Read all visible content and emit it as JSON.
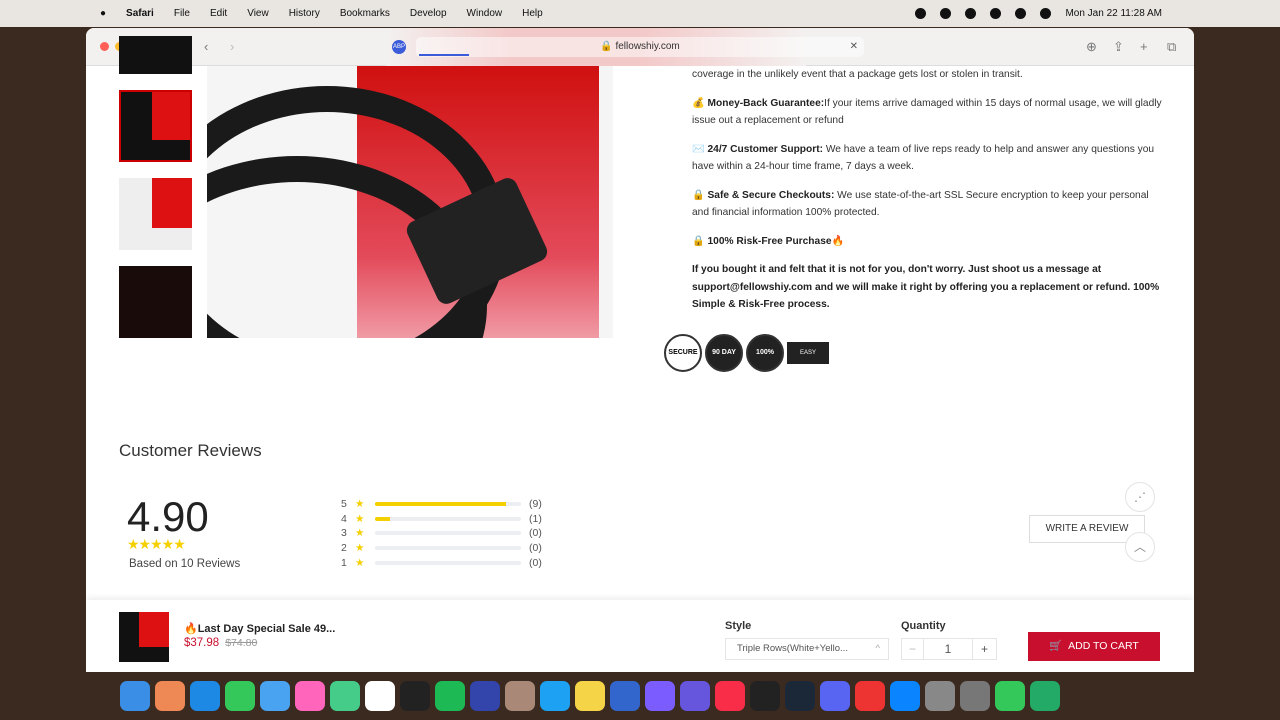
{
  "menubar": {
    "app": "Safari",
    "items": [
      "File",
      "Edit",
      "View",
      "History",
      "Bookmarks",
      "Develop",
      "Window",
      "Help"
    ],
    "clock": "Mon Jan 22  11:28 AM"
  },
  "browser": {
    "url": "fellowshiy.com",
    "abp": "ABP"
  },
  "info": {
    "p0": "coverage in the unlikely event that a package gets lost or stolen in transit.",
    "p1_title": "Money-Back Guarantee:",
    "p1_text": "If your items arrive damaged within 15 days of normal usage, we will gladly issue out a replacement or refund",
    "p2_title": "24/7 Customer Support:",
    "p2_text": " We have a team of live reps ready to help and answer any questions you have within a 24-hour time frame, 7 days a week.",
    "p3_title": "Safe & Secure Checkouts:",
    "p3_text": " We use state-of-the-art SSL Secure encryption to keep your personal and financial information 100% protected.",
    "p4_title": "100% Risk-Free Purchase🔥",
    "p5": "If you bought it and felt that it is not for you, don't worry. Just shoot us a message at support@fellowshiy.com and we will make it right by offering you a replacement or refund. 100% Simple & Risk-Free process."
  },
  "badges": [
    "SECURE",
    "90 DAY",
    "100%",
    "EASY RETURN"
  ],
  "reviews": {
    "title": "Customer Reviews",
    "score": "4.90",
    "stars": "★★★★★",
    "based": "Based on 10 Reviews",
    "write": "WRITE A REVIEW",
    "rows": [
      {
        "star": "5",
        "count": "(9)",
        "pct": 90
      },
      {
        "star": "4",
        "count": "(1)",
        "pct": 10
      },
      {
        "star": "3",
        "count": "(0)",
        "pct": 0
      },
      {
        "star": "2",
        "count": "(0)",
        "pct": 0
      },
      {
        "star": "1",
        "count": "(0)",
        "pct": 0
      }
    ]
  },
  "sticky": {
    "title": "🔥Last Day Special Sale 49...",
    "price": "$37.98",
    "old_price": "$74.80",
    "style_label": "Style",
    "style_value": "Triple Rows(White+Yello...",
    "qty_label": "Quantity",
    "qty": "1",
    "minus": "−",
    "plus": "+",
    "cart": "ADD TO CART"
  },
  "colors": {
    "accent": "#c8102e",
    "star": "#f5d000"
  }
}
